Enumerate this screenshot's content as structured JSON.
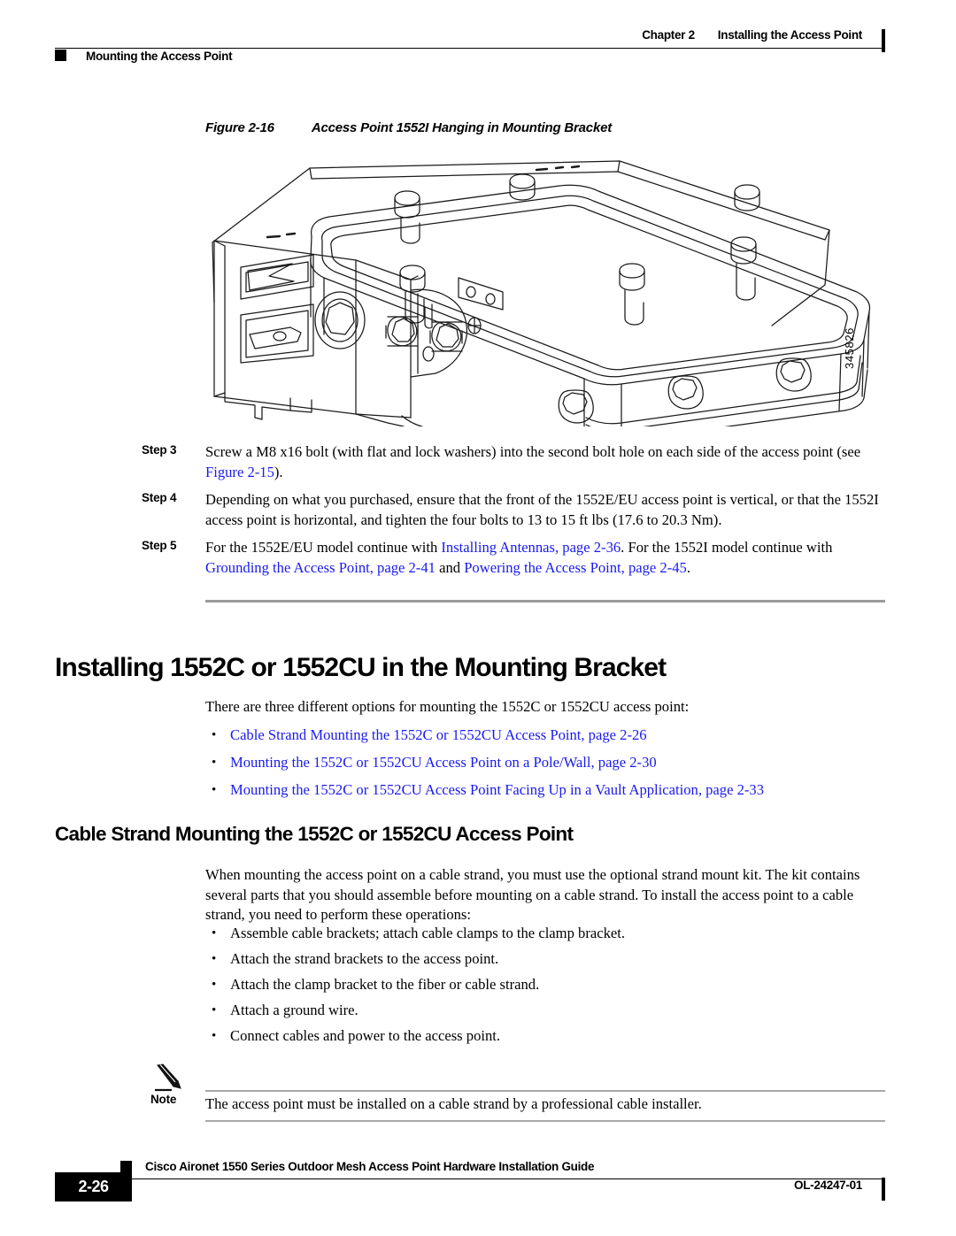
{
  "header": {
    "chapter_number": "Chapter 2",
    "chapter_title": "Installing the Access Point",
    "section_title": "Mounting the Access Point"
  },
  "figure": {
    "label": "Figure 2-16",
    "title": "Access Point 1552I Hanging in Mounting Bracket",
    "graphic_id": "345826"
  },
  "steps": [
    {
      "label": "Step 3",
      "text_before": "Screw a M8 x16 bolt (with flat and lock washers) into the second bolt hole on each side of the access point (see ",
      "link": "Figure 2-15",
      "text_after": ")."
    },
    {
      "label": "Step 4",
      "text_before": "Depending on what you purchased, ensure that the front of the 1552E/EU access point is vertical, or that the 1552I access point is horizontal, and tighten the four bolts to 13 to 15 ft lbs (17.6 to 20.3 Nm).",
      "link": "",
      "text_after": ""
    }
  ],
  "step5": {
    "label": "Step 5",
    "part1": "For the 1552E/EU model continue with ",
    "link1": "Installing Antennas, page 2-36",
    "part2": ". For the 1552I model continue with ",
    "link2": "Grounding the Access Point, page 2-41",
    "part3": " and ",
    "link3": "Powering the Access Point, page 2-45",
    "part4": "."
  },
  "heading_main": "Installing 1552C or 1552CU in the Mounting Bracket",
  "intro_paragraph": "There are three different options for mounting the 1552C or 1552CU access point:",
  "option_links": [
    "Cable Strand Mounting the 1552C or 1552CU Access Point, page 2-26",
    "Mounting the 1552C or 1552CU Access Point on a Pole/Wall, page 2-30",
    "Mounting the 1552C or 1552CU Access Point Facing Up in a Vault Application, page 2-33"
  ],
  "heading_sub": "Cable Strand Mounting the 1552C or 1552CU Access Point",
  "cable_paragraph": "When mounting the access point on a cable strand, you must use the optional strand mount kit. The kit contains several parts that you should assemble before mounting on a cable strand. To install the access point to a cable strand, you need to perform these operations:",
  "operations": [
    "Assemble cable brackets; attach cable clamps to the clamp bracket.",
    "Attach the strand brackets to the access point.",
    "Attach the clamp bracket to the fiber or cable strand.",
    "Attach a ground wire.",
    "Connect cables and power to the access point."
  ],
  "note": {
    "label": "Note",
    "text": "The access point must be installed on a cable strand by a professional cable installer."
  },
  "footer": {
    "page_number": "2-26",
    "document_title": "Cisco Aironet 1550 Series Outdoor Mesh Access Point Hardware Installation Guide",
    "document_id": "OL-24247-01"
  },
  "colors": {
    "link": "#1a1aee",
    "rule_grey": "#9a9a9a",
    "text": "#000000"
  }
}
